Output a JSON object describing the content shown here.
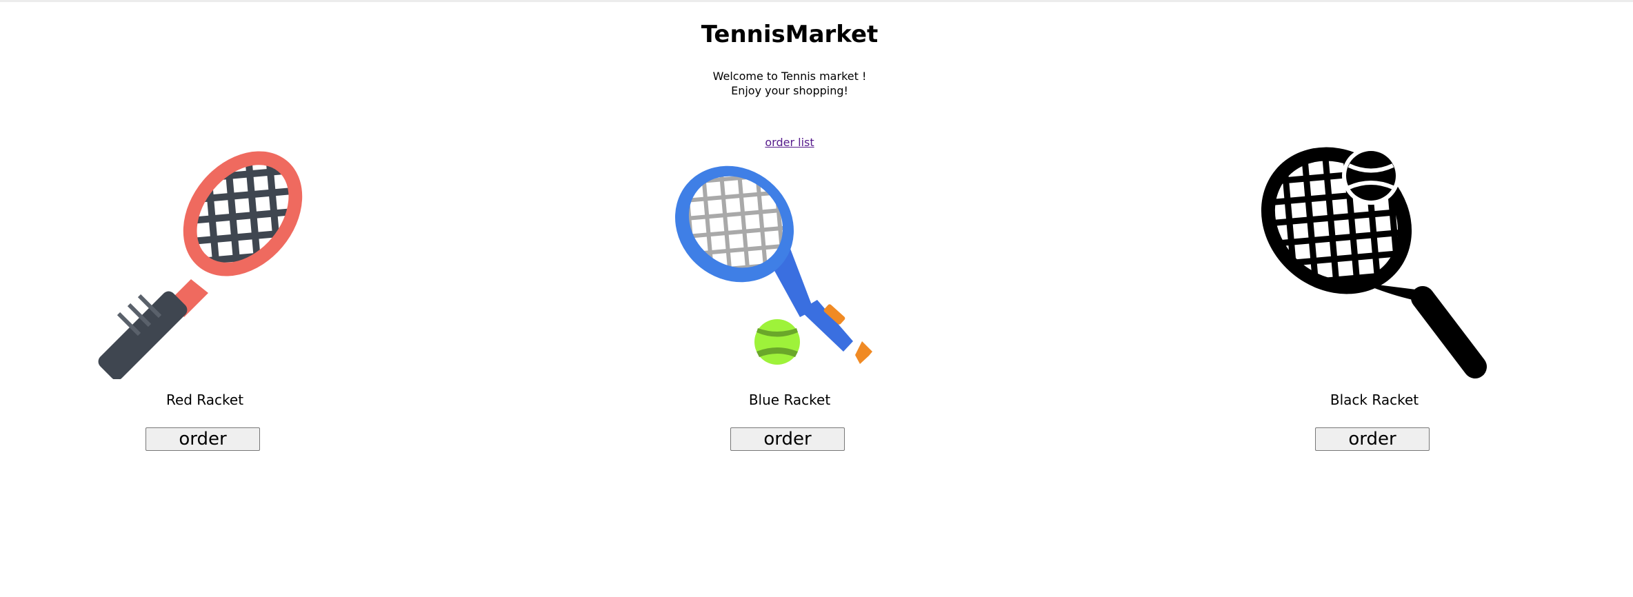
{
  "header": {
    "title": "TennisMarket",
    "welcome_line1": "Welcome to Tennis market !",
    "welcome_line2": "Enjoy your shopping!",
    "order_list_label": "order list"
  },
  "products": [
    {
      "name": "Red Racket",
      "order_label": "order",
      "icon": "red-racket-icon",
      "color": "#ef6a5f"
    },
    {
      "name": "Blue Racket",
      "order_label": "order",
      "icon": "blue-racket-icon",
      "color": "#3f7fe6"
    },
    {
      "name": "Black Racket",
      "order_label": "order",
      "icon": "black-racket-icon",
      "color": "#000000"
    }
  ]
}
